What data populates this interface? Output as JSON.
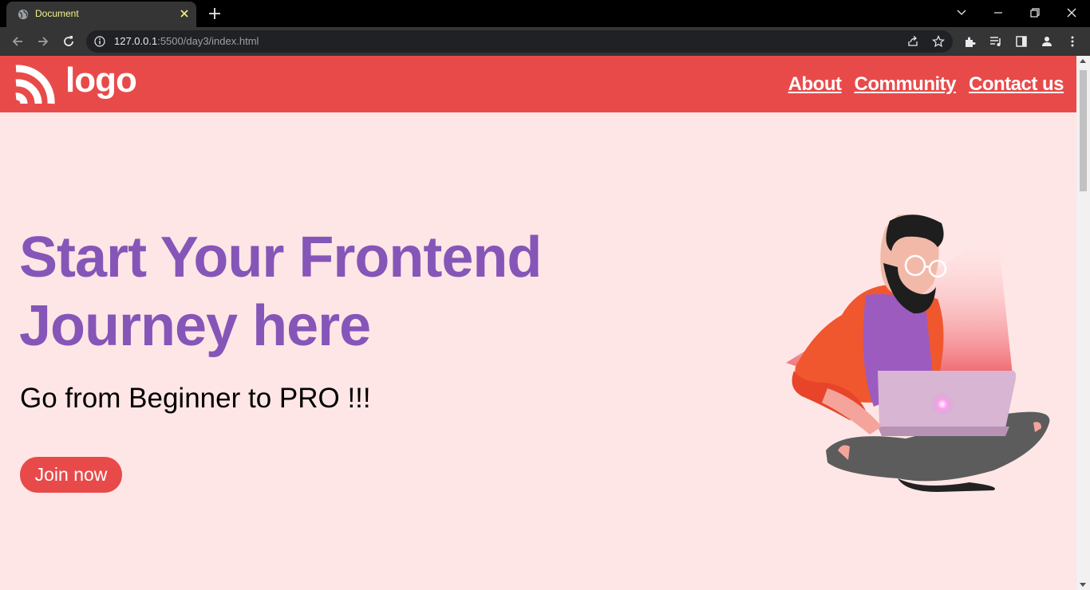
{
  "browser": {
    "tab_title": "Document",
    "url_host": "127.0.0.1",
    "url_rest": ":5500/day3/index.html"
  },
  "site": {
    "logo_text": "logo",
    "nav": [
      "About",
      "Community",
      "Contact us"
    ],
    "hero_title": "Start Your Frontend Journey here",
    "hero_subtitle": "Go from Beginner to PRO !!!",
    "cta_label": "Join now"
  },
  "colors": {
    "brand_red": "#e84a4a",
    "page_bg": "#ffe6e6",
    "title_purple": "#8556b8"
  },
  "icons": {
    "tab": [
      "globe-icon",
      "close-icon",
      "plus-icon"
    ],
    "window": [
      "chevron-down-icon",
      "minimize-icon",
      "restore-icon",
      "close-icon"
    ],
    "toolbar": [
      "back-icon",
      "forward-icon",
      "reload-icon",
      "info-icon",
      "share-icon",
      "star-icon",
      "extensions-icon",
      "media-icon",
      "sidepanel-icon",
      "profile-icon",
      "menu-icon"
    ]
  }
}
